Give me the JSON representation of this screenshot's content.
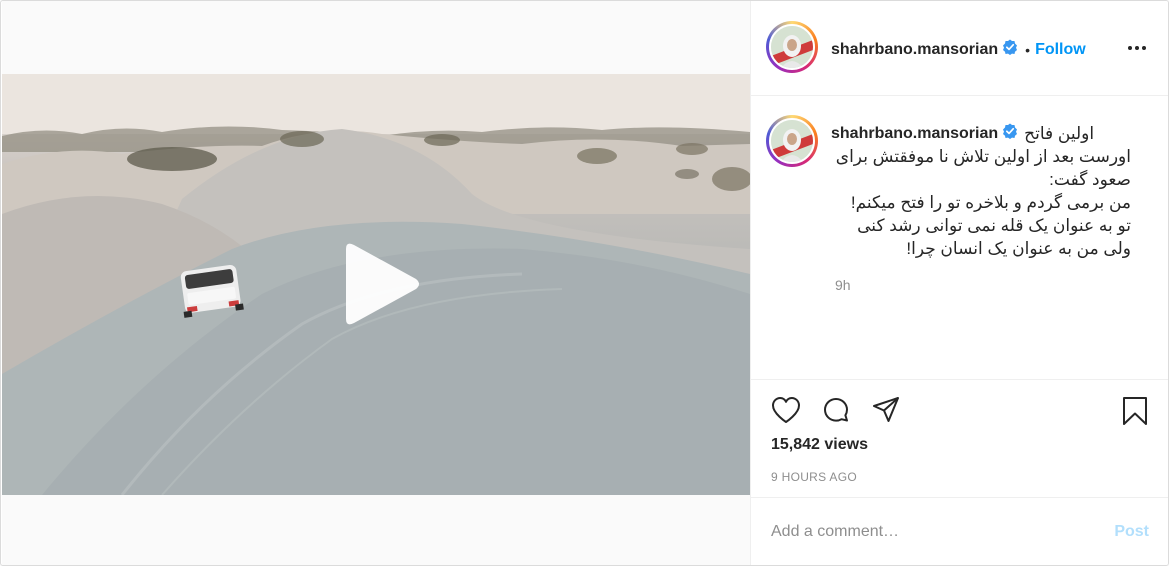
{
  "post": {
    "username": "shahrbano.mansorian",
    "verified": true,
    "follow_dot": "•",
    "follow_label": "Follow",
    "more_icon": "more-horizontal-icon",
    "caption": {
      "line1": "اولین فاتح",
      "line2": "اورست بعد از اولین تلاش نا موفقتش برای",
      "line3": "صعود گفت:",
      "line4": "من برمی گردم و بلاخره تو را فتح میکنم!",
      "line5": "تو به عنوان یک قله نمی توانی رشد کنی",
      "line6": "ولی من به عنوان یک انسان چرا!"
    },
    "caption_time": "9h",
    "views": "15,842 views",
    "time_ago": "9 HOURS AGO",
    "comment_placeholder": "Add a comment…",
    "post_label": "Post",
    "icons": {
      "like": "heart-icon",
      "comment": "comment-icon",
      "share": "paper-plane-icon",
      "save": "bookmark-icon",
      "play": "play-icon"
    },
    "colors": {
      "accent": "#0095f6",
      "post_disabled": "#b2dffc",
      "verified": "#3897f0",
      "muted": "#8e8e8e"
    }
  }
}
